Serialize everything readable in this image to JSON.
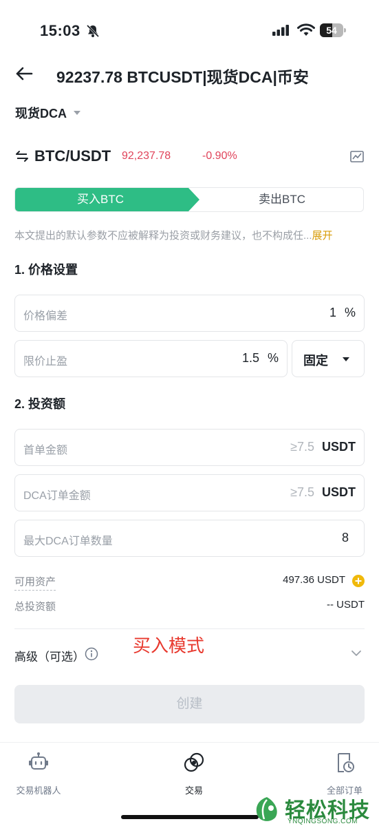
{
  "status_bar": {
    "time": "15:03",
    "battery_level": "54",
    "battery_fraction": 0.54
  },
  "header": {
    "title": "92237.78 BTCUSDT|现货DCA|币安"
  },
  "strategy": {
    "label": "现货DCA"
  },
  "pair": {
    "name": "BTC/USDT",
    "price": "92,237.78",
    "change": "-0.90%",
    "change_color": "#e0435a"
  },
  "tabs": {
    "buy_label": "买入BTC",
    "sell_label": "卖出BTC",
    "active": "buy",
    "buy_color": "#2ebd85"
  },
  "disclaimer": {
    "text": "本文提出的默认参数不应被解释为投资或财务建议，也不构成任...",
    "expand_label": "展开"
  },
  "price_settings": {
    "title": "1. 价格设置",
    "deviation": {
      "label": "价格偏差",
      "value": "1",
      "unit": "%"
    },
    "take_profit": {
      "label": "限价止盈",
      "value": "1.5",
      "unit": "%"
    },
    "mode_select": {
      "value": "固定"
    }
  },
  "investment": {
    "title": "2. 投资额",
    "first_order": {
      "label": "首单金额",
      "hint": "≥7.5",
      "unit": "USDT"
    },
    "dca_order": {
      "label": "DCA订单金额",
      "hint": "≥7.5",
      "unit": "USDT"
    },
    "max_dca_orders": {
      "label": "最大DCA订单数量",
      "value": "8"
    }
  },
  "balances": {
    "available": {
      "label": "可用资产",
      "value": "497.36 USDT"
    },
    "total": {
      "label": "总投资额",
      "value": "-- USDT"
    }
  },
  "advanced": {
    "label": "高级（可选）"
  },
  "annotation": {
    "text": "买入模式"
  },
  "create_button": {
    "label": "创建"
  },
  "bottom_nav": {
    "items": [
      {
        "label": "交易机器人",
        "icon": "robot-icon"
      },
      {
        "label": "交易",
        "icon": "trade-icon"
      },
      {
        "label": "全部订单",
        "icon": "orders-icon"
      }
    ]
  },
  "watermark": {
    "cn": "轻松科技",
    "en": "YNQINGSONG.COM"
  }
}
